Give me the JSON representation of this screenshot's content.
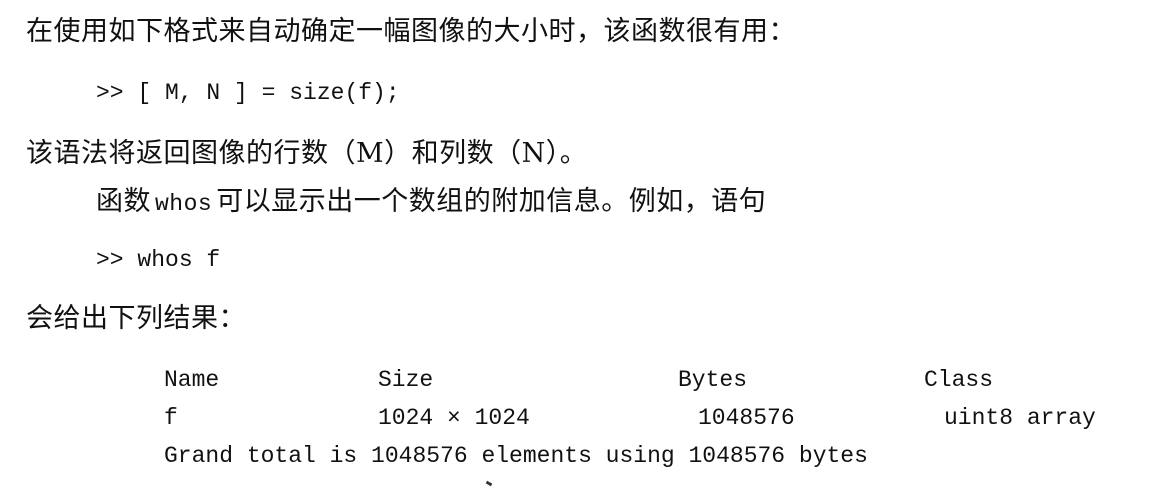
{
  "para1": "在使用如下格式来自动确定一幅图像的大小时，该函数很有用：",
  "code1": ">> [ M, N ] = size(f);",
  "para2": "该语法将返回图像的行数（M）和列数（N）。",
  "para3": {
    "before": "函数",
    "code": "whos",
    "after": "可以显示出一个数组的附加信息。例如，语句"
  },
  "code2": ">> whos f",
  "para4": "会给出下列结果：",
  "whos_output": {
    "headers": [
      "Name",
      "Size",
      "Bytes",
      "Class"
    ],
    "row": [
      "f",
      "1024 × 1024",
      "1048576",
      "uint8 array"
    ],
    "total": "Grand total is 1048576 elements using 1048576 bytes"
  }
}
